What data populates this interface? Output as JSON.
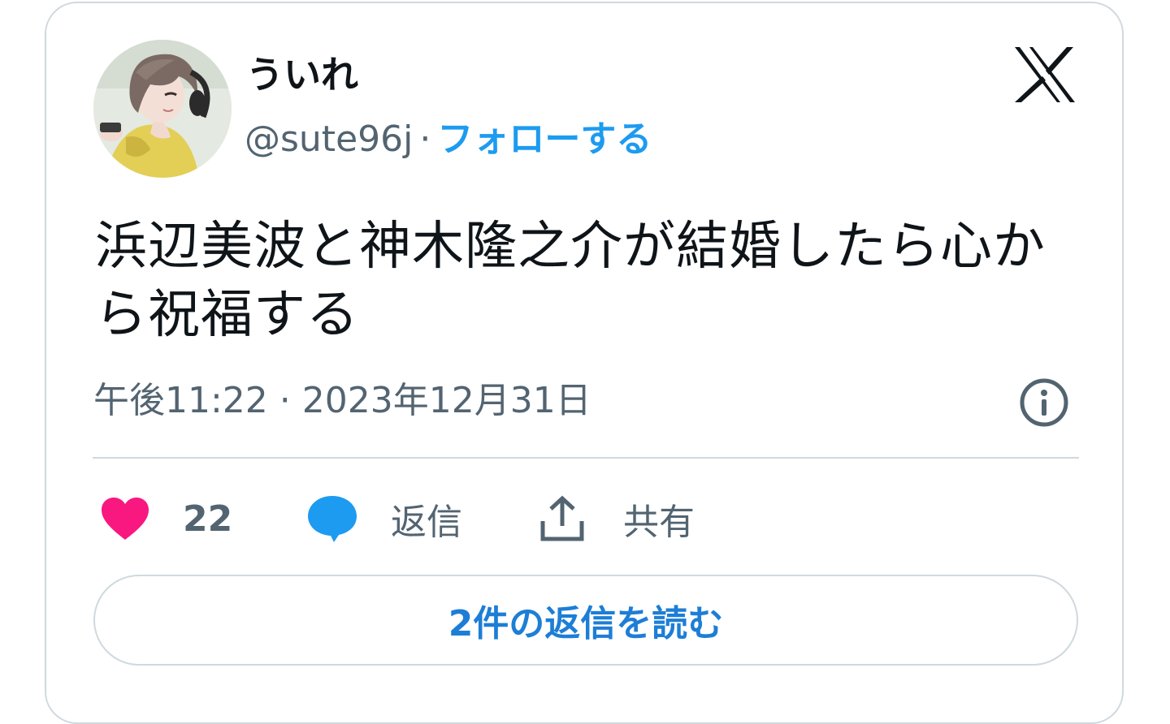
{
  "author": {
    "display_name": "ういれ",
    "handle": "@sute96j",
    "separator": "·",
    "follow_label": "フォローする",
    "avatar_icon": "user-avatar-illustration"
  },
  "platform_icon": "x-logo-icon",
  "tweet": {
    "text": "浜辺美波と神木隆之介が結婚したら心から祝福する",
    "timestamp": "午後11:22 · 2023年12月31日"
  },
  "actions": {
    "like_count": "22",
    "reply_label": "返信",
    "share_label": "共有"
  },
  "read_replies_label": "2件の返信を読む",
  "colors": {
    "accent": "#1d9bf0",
    "like": "#f91880",
    "reply": "#1d9bf0",
    "secondary_text": "#536471",
    "border": "#cfd9de"
  }
}
